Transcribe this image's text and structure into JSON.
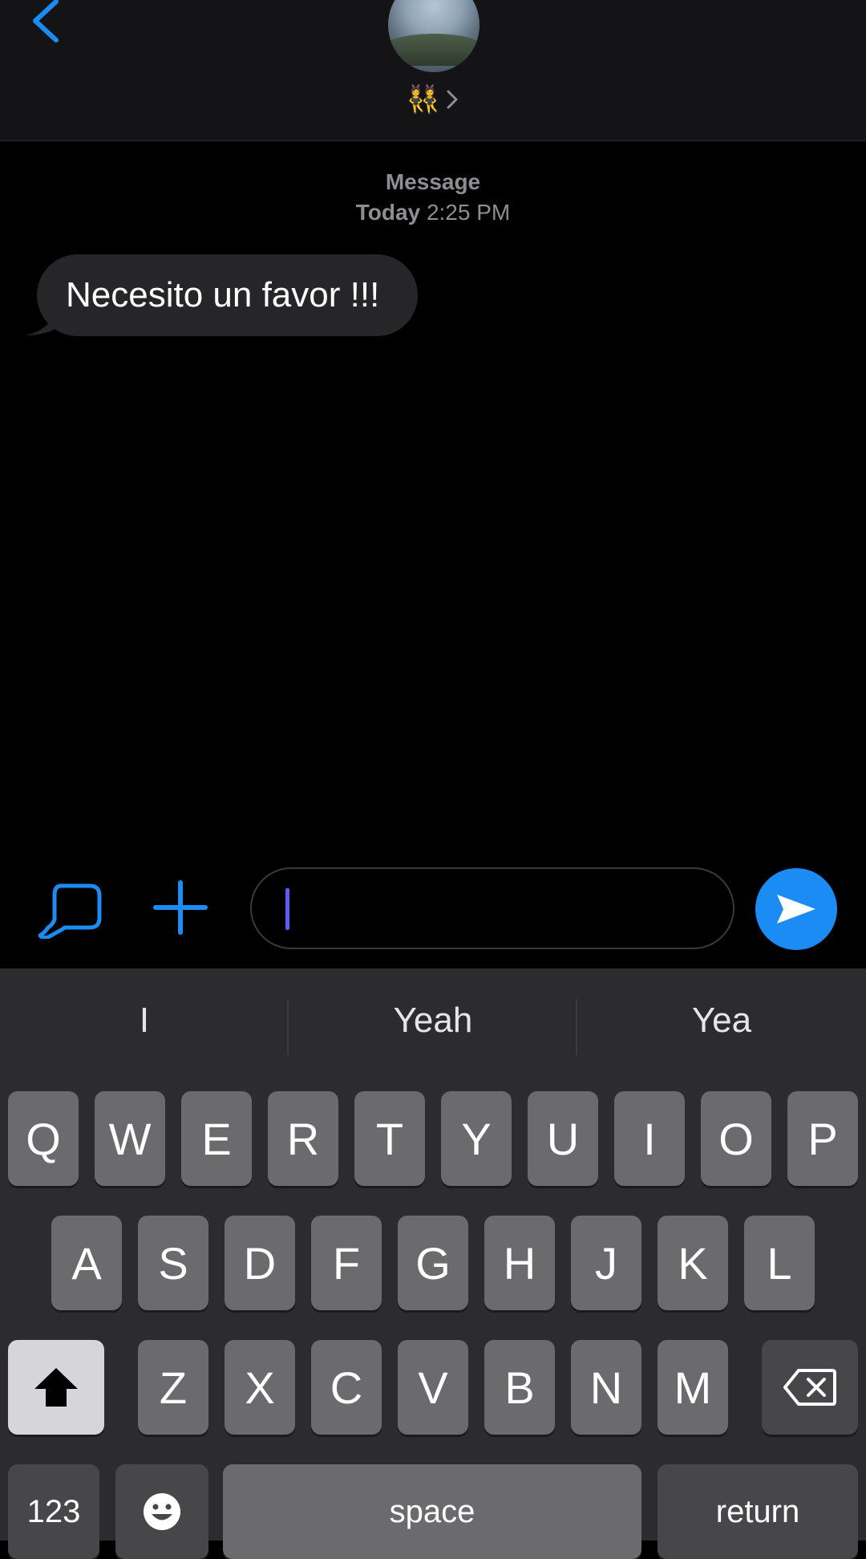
{
  "header": {
    "contact_name": "👯",
    "back_icon": "chevron-left-icon"
  },
  "thread": {
    "service_label": "Message",
    "day_label": "Today",
    "time_label": "2:25 PM",
    "messages": [
      {
        "text": "Necesito un favor !!!",
        "direction": "incoming"
      }
    ]
  },
  "compose": {
    "input_value": "",
    "apps_icon": "app-drawer-icon",
    "plus_icon": "plus-icon",
    "send_icon": "send-icon"
  },
  "keyboard": {
    "suggestions": [
      "I",
      "Yeah",
      "Yea"
    ],
    "row1": [
      "Q",
      "W",
      "E",
      "R",
      "T",
      "Y",
      "U",
      "I",
      "O",
      "P"
    ],
    "row2": [
      "A",
      "S",
      "D",
      "F",
      "G",
      "H",
      "J",
      "K",
      "L"
    ],
    "row3": [
      "Z",
      "X",
      "C",
      "V",
      "B",
      "N",
      "M"
    ],
    "numbers_label": "123",
    "space_label": "space",
    "return_label": "return"
  },
  "colors": {
    "accent": "#1c8cf5",
    "bubble_incoming": "#262628",
    "keyboard_bg": "#2c2c2e"
  }
}
